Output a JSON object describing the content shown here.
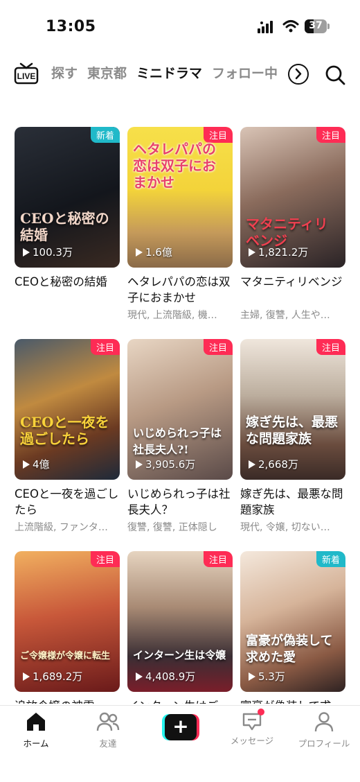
{
  "status_bar": {
    "time": "13:05",
    "battery": "37"
  },
  "top_nav": {
    "live_label": "LIVE",
    "tabs": [
      {
        "label": "探す"
      },
      {
        "label": "東京都"
      },
      {
        "label": "ミニドラマ"
      },
      {
        "label": "フォロー中"
      }
    ]
  },
  "cards": [
    {
      "badge": "新着",
      "views": "100.3万",
      "overlay": "CEOと秘密の結婚",
      "title": "CEOと秘密の結婚",
      "tags": ""
    },
    {
      "badge": "注目",
      "views": "1.6億",
      "overlay": "ヘタレパパの恋は双子におまかせ",
      "title": "ヘタレパパの恋は双子におまかせ",
      "tags": "現代, 上流階級, 機…"
    },
    {
      "badge": "注目",
      "views": "1,821.2万",
      "overlay": "マタニティリベンジ",
      "title": "マタニティリベンジ",
      "tags": "主婦, 復讐, 人生や…"
    },
    {
      "badge": "注目",
      "views": "4億",
      "overlay": "CEOと一夜を過ごしたら",
      "title": "CEOと一夜を過ごしたら",
      "tags": "上流階級, ファンタ…"
    },
    {
      "badge": "注目",
      "views": "3,905.6万",
      "overlay": "いじめられっ子は社長夫人?!",
      "title": "いじめられっ子は社長夫人？",
      "tags": "復讐, 復讐, 正体隠し"
    },
    {
      "badge": "注目",
      "views": "2,668万",
      "overlay": "嫁ぎ先は、最悪な問題家族",
      "title": "嫁ぎ先は、最悪な問題家族",
      "tags": "現代, 令嬢, 切ない…"
    },
    {
      "badge": "注目",
      "views": "1,689.2万",
      "overlay": "ご令嬢様が令嬢に転生",
      "title": "追放令嬢の神雲",
      "tags": ""
    },
    {
      "badge": "注目",
      "views": "4,408.9万",
      "overlay": "インターン生は令嬢",
      "title": "インターン生はご",
      "tags": ""
    },
    {
      "badge": "新着",
      "views": "5.3万",
      "overlay": "富豪が偽装して求めた愛",
      "title": "富豪が偽装して求",
      "tags": ""
    }
  ],
  "bottom_bar": {
    "items": [
      {
        "label": "ホーム"
      },
      {
        "label": "友達"
      },
      {
        "label": ""
      },
      {
        "label": "メッセージ"
      },
      {
        "label": "プロフィール"
      }
    ]
  },
  "colors": {
    "accent_red": "#fe2c55",
    "accent_teal": "#20b9c9",
    "muted": "#8a8a8a"
  }
}
